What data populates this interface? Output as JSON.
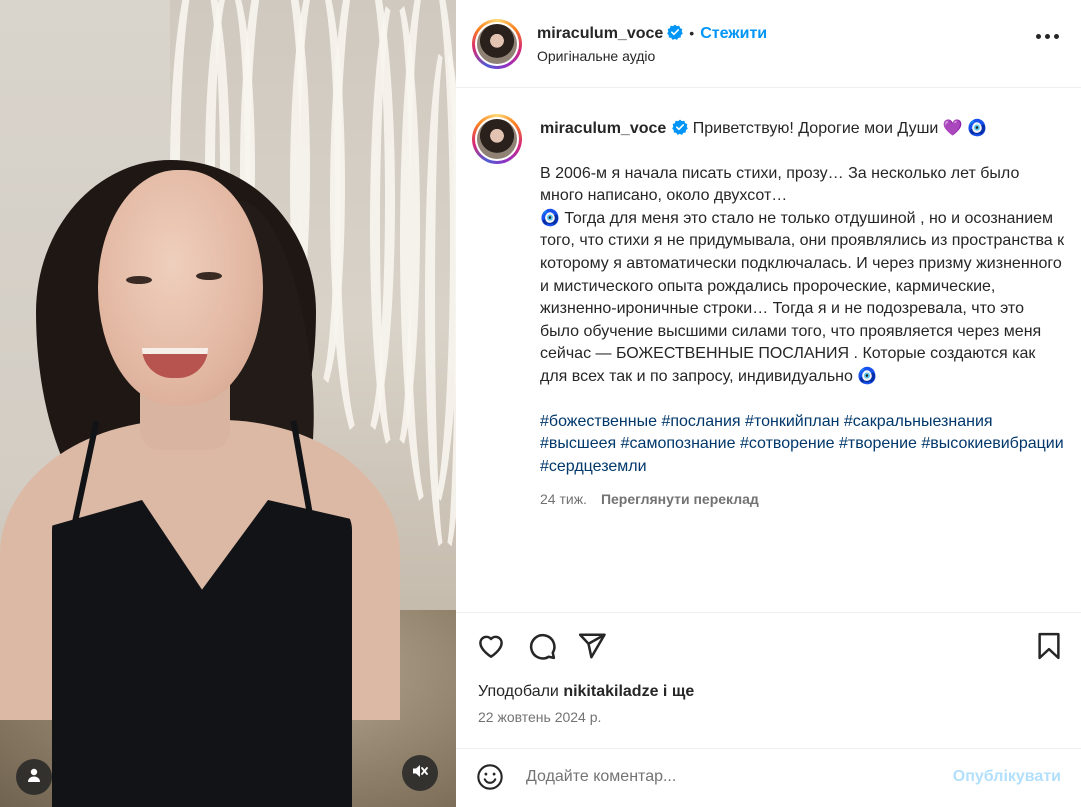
{
  "post": {
    "username": "miraculum_voce",
    "follow_label": "Стежити",
    "separator": "•",
    "audio_label": "Оригінальне аудіо"
  },
  "caption": {
    "username": "miraculum_voce",
    "greeting": "Приветствую! Дорогие мои Души 💜 🧿",
    "body": "В 2006-м я начала писать стихи, прозу… За несколько лет было много написано, около двухсот…\n🧿 Тогда для меня это стало не только отдушиной , но и осознанием того, что стихи я не придумывала, они проявлялись из пространства к которому я автоматически подключалась. И через призму жизненного и мистического опыта рождались пророческие, кармические, жизненно-ироничные строки… Тогда я и не подозревала, что это было обучение высшими силами того, что проявляется через меня сейчас — БОЖЕСТВЕННЫЕ ПОСЛАНИЯ . Которые создаются как для всех так и по запросу, индивидуально 🧿",
    "hashtags": [
      "#божественные",
      "#послания",
      "#тонкийплан",
      "#сакральныезнания",
      "#высшеея",
      "#самопознание",
      "#сотворение",
      "#творение",
      "#высокиевибрации",
      "#сердцеземли"
    ],
    "age": "24 тиж.",
    "translate_label": "Переглянути переклад"
  },
  "likes": {
    "prefix": "Уподобали",
    "user": "nikitakiladze",
    "suffix": "і ще"
  },
  "date": "22 жовтень 2024 р.",
  "comment": {
    "placeholder": "Додайте коментар...",
    "post_label": "Опублікувати"
  },
  "icons": {
    "verified": "verified-badge-icon",
    "more": "more-options-icon",
    "like": "heart-icon",
    "comment": "comment-bubble-icon",
    "share": "paper-plane-icon",
    "save": "bookmark-icon",
    "emoji": "smiley-icon",
    "tagged": "person-icon",
    "mute": "speaker-muted-icon"
  },
  "colors": {
    "accent": "#0095f6",
    "hashtag": "#00376b",
    "muted_text": "#737373",
    "post_disabled": "#b2dffc"
  }
}
